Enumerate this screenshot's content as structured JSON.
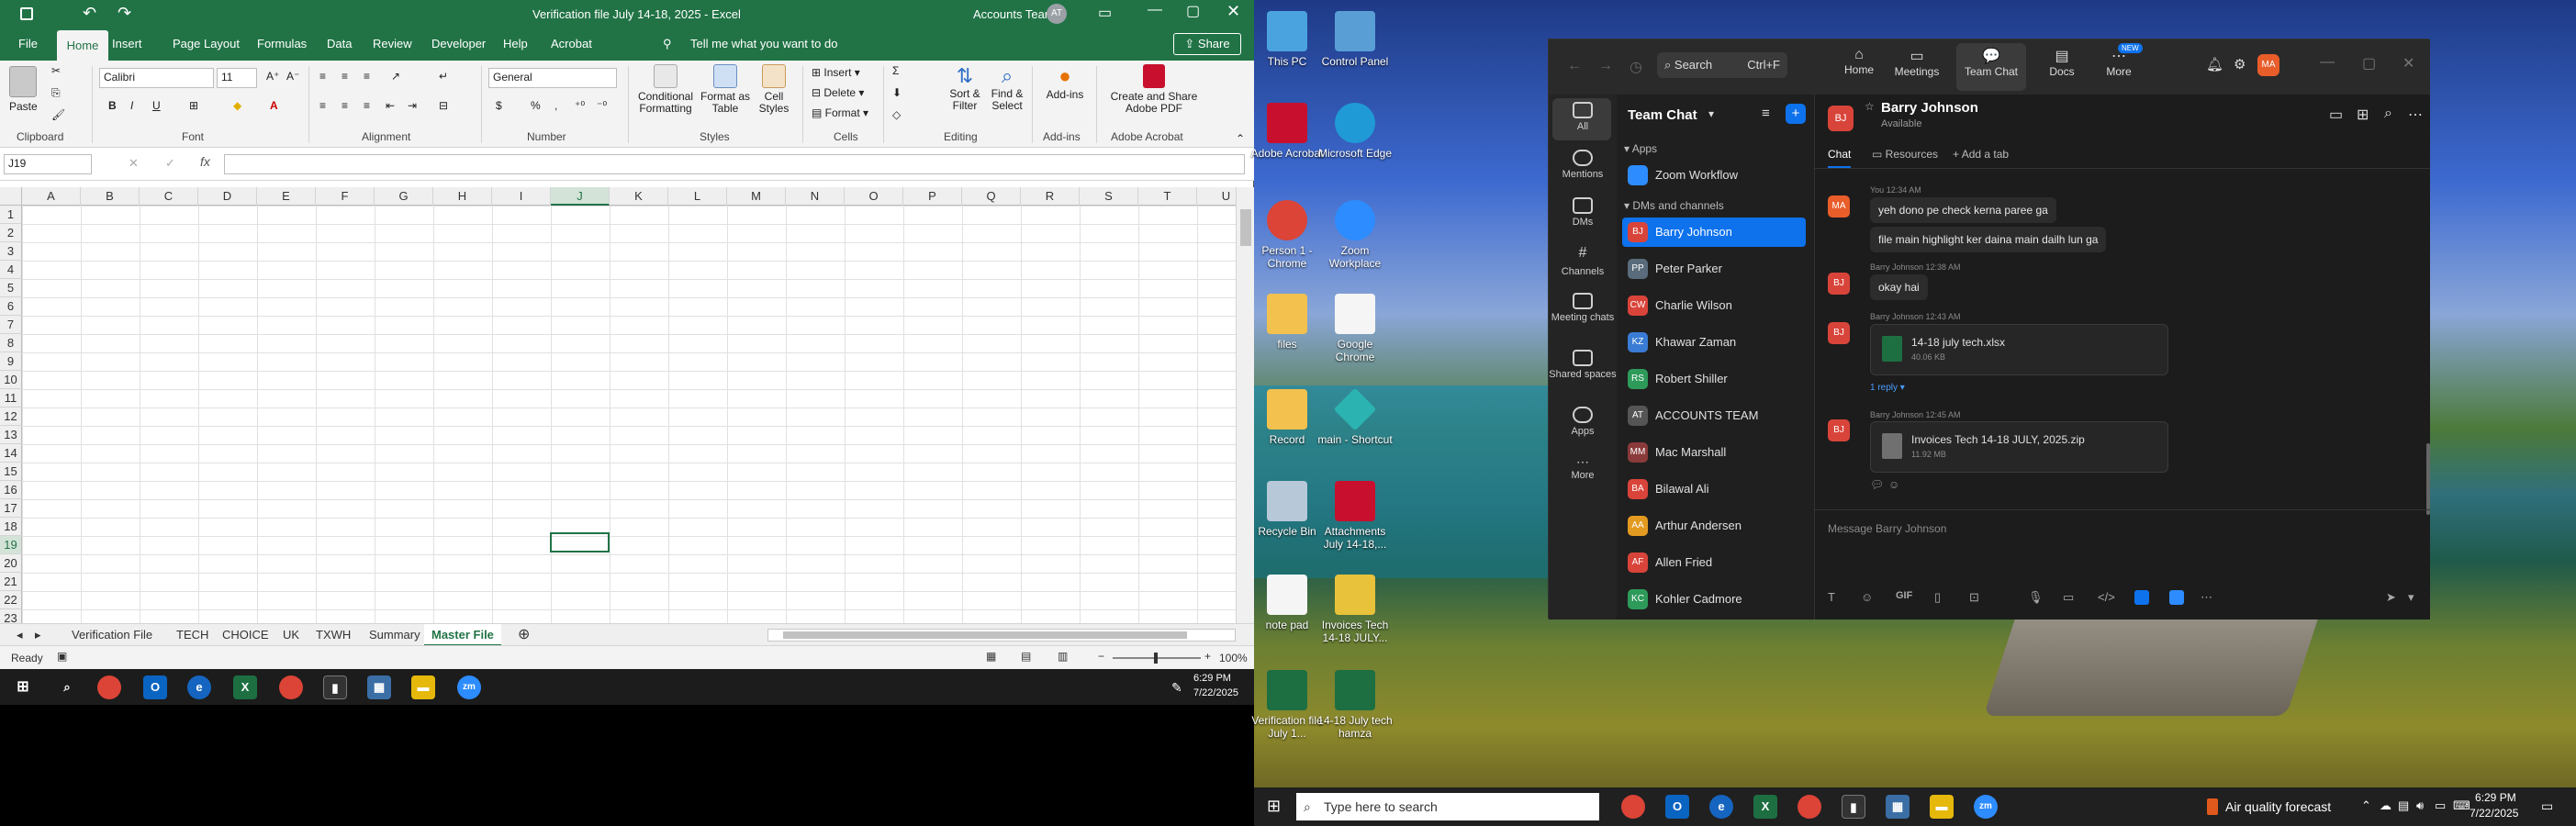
{
  "excel": {
    "window_title": "Verification file July 14-18, 2025  -  Excel",
    "account": "Accounts Team",
    "account_initials": "AT",
    "share_label": "Share",
    "tabs": [
      "File",
      "Home",
      "Insert",
      "Page Layout",
      "Formulas",
      "Data",
      "Review",
      "Developer",
      "Help",
      "Acrobat"
    ],
    "tell_me": "Tell me what you want to do",
    "ribbon": {
      "paste": "Paste",
      "font_name": "Calibri",
      "font_size": "11",
      "number_format": "General",
      "conditional": "Conditional Formatting",
      "format_table": "Format as Table",
      "cell_styles": "Cell Styles",
      "insert": "Insert",
      "delete": "Delete",
      "format": "Format",
      "sort": "Sort & Filter",
      "find": "Find & Select",
      "addins": "Add-ins",
      "create_pdf": "Create and Share Adobe PDF",
      "groups": [
        "Clipboard",
        "Font",
        "Alignment",
        "Number",
        "Styles",
        "Cells",
        "Editing",
        "Add-ins",
        "Adobe Acrobat"
      ]
    },
    "name_box": "J19",
    "columns": [
      "A",
      "B",
      "C",
      "D",
      "E",
      "F",
      "G",
      "H",
      "I",
      "J",
      "K",
      "L",
      "M",
      "N",
      "O",
      "P",
      "Q",
      "R",
      "S",
      "T",
      "U"
    ],
    "rows": [
      "1",
      "2",
      "3",
      "4",
      "5",
      "6",
      "7",
      "8",
      "9",
      "10",
      "11",
      "12",
      "13",
      "14",
      "15",
      "16",
      "17",
      "18",
      "19",
      "20",
      "21",
      "22",
      "23"
    ],
    "sheets": [
      "Verification File",
      "TECH",
      "CHOICE",
      "UK",
      "TXWH",
      "Summary",
      "Master File"
    ],
    "active_sheet": "Master File",
    "status": "Ready",
    "zoom": "100%",
    "taskbar_time": "6:29 PM",
    "taskbar_date": "7/22/2025"
  },
  "desktop": {
    "icons": [
      {
        "label": "This PC"
      },
      {
        "label": "Control Panel"
      },
      {
        "label": "Adobe Acrobat"
      },
      {
        "label": "Microsoft Edge"
      },
      {
        "label": "Person 1 - Chrome"
      },
      {
        "label": "Zoom Workplace"
      },
      {
        "label": "files"
      },
      {
        "label": "Google Chrome"
      },
      {
        "label": "Record"
      },
      {
        "label": "main - Shortcut"
      },
      {
        "label": "Recycle Bin"
      },
      {
        "label": "Attachments July 14-18,..."
      },
      {
        "label": "note pad"
      },
      {
        "label": "Invoices Tech 14-18 JULY..."
      },
      {
        "label": "Verification file July 1..."
      },
      {
        "label": "14-18 July tech hamza"
      }
    ]
  },
  "zoom": {
    "search_placeholder": "Search",
    "search_shortcut": "Ctrl+F",
    "nav": [
      {
        "label": "Home"
      },
      {
        "label": "Meetings"
      },
      {
        "label": "Team Chat"
      },
      {
        "label": "Docs"
      },
      {
        "label": "More"
      }
    ],
    "new_badge": "NEW",
    "user_initials": "MA",
    "rail": [
      "All",
      "Mentions",
      "DMs",
      "Channels",
      "Meeting chats",
      "Shared spaces",
      "Apps",
      "More"
    ],
    "list_title": "Team Chat",
    "section_apps": "Apps",
    "app_item": "Zoom Workflow",
    "section_dms": "DMs and channels",
    "contacts": [
      {
        "name": "Barry Johnson",
        "initials": "BJ",
        "color": "#d9443a"
      },
      {
        "name": "Peter Parker",
        "initials": "PP",
        "color": "#5a6b7b"
      },
      {
        "name": "Charlie Wilson",
        "initials": "CW",
        "color": "#d9443a"
      },
      {
        "name": "Khawar Zaman",
        "initials": "KZ",
        "color": "#3a7bd5"
      },
      {
        "name": "Robert Shiller",
        "initials": "RS",
        "color": "#2e9a5a"
      },
      {
        "name": "ACCOUNTS TEAM",
        "initials": "AT",
        "color": "#555555"
      },
      {
        "name": "Mac Marshall",
        "initials": "MM",
        "color": "#8a3a3a"
      },
      {
        "name": "Bilawal Ali",
        "initials": "BA",
        "color": "#d9443a"
      },
      {
        "name": "Arthur Andersen",
        "initials": "AA",
        "color": "#e39a20"
      },
      {
        "name": "Allen Fried",
        "initials": "AF",
        "color": "#d9443a"
      },
      {
        "name": "Kohler Cadmore",
        "initials": "KC",
        "color": "#2e9a5a"
      }
    ],
    "chat_name": "Barry Johnson",
    "chat_initials": "BJ",
    "chat_status": "Available",
    "chat_tabs": [
      "Chat",
      "Resources",
      "Add a tab"
    ],
    "messages": [
      {
        "meta": "You 12:34 AM",
        "text": "yeh dono pe check kerna paree ga",
        "initials": "MA"
      },
      {
        "text": "file main highlight ker daina main dailh lun ga"
      },
      {
        "meta": "Barry Johnson 12:38 AM",
        "text": "okay hai",
        "initials": "BJ"
      },
      {
        "meta": "Barry Johnson 12:43 AM",
        "file": "14-18 july tech.xlsx",
        "size": "40.06 KB",
        "initials": "BJ",
        "reply": "1 reply"
      },
      {
        "meta": "Barry Johnson 12:45 AM",
        "file": "Invoices Tech 14-18  JULY, 2025.zip",
        "size": "11.92 MB",
        "initials": "BJ"
      }
    ],
    "compose_placeholder": "Message Barry Johnson",
    "gif": "GIF"
  },
  "taskbar": {
    "search_placeholder": "Type here to search",
    "weather": "Air quality forecast",
    "time": "6:29 PM",
    "date": "7/22/2025"
  }
}
